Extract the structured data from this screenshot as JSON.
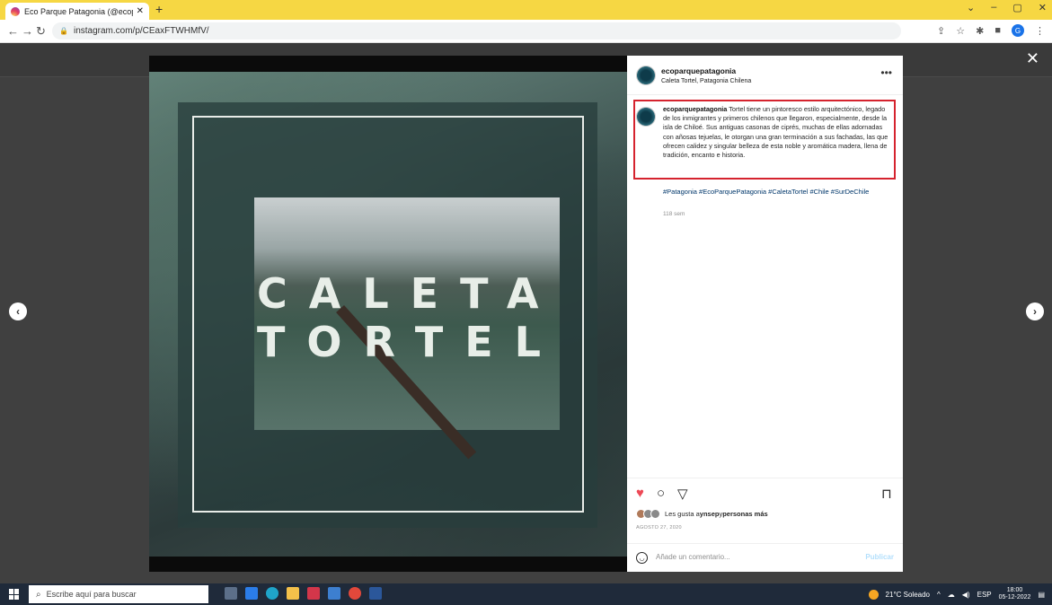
{
  "browser": {
    "tab_title": "Eco Parque Patagonia (@ecoparc",
    "tab_close": "✕",
    "new_tab": "+",
    "url": "instagram.com/p/CEaxFTWHMfV/",
    "controls": [
      "⌄",
      "–",
      "▢",
      "✕"
    ]
  },
  "post": {
    "image_title_line1": "CALETA",
    "image_title_line2": "TORTEL"
  },
  "panel": {
    "username": "ecoparquepatagonia",
    "location": "Caleta Tortel, Patagonia Chilena",
    "more": "•••",
    "caption_username": "ecoparquepatagonia",
    "caption": "Tortel tiene un pintoresco estilo arquitectónico, legado de los inmigrantes y primeros chilenos que llegaron, especialmente, desde la isla de Chiloé. Sus antiguas casonas de ciprés, muchas de ellas adornadas con añosas tejuelas, le otorgan una gran terminación a sus fachadas, las que ofrecen calidez y singular belleza de esta noble y aromática madera, llena de tradición, encanto e historia.",
    "hashtags": "#Patagonia #EcoParquePatagonia #CaletaTortel #Chile #SurDeChile",
    "time_ago": "118 sem",
    "likes_prefix": "Les gusta a ",
    "likes_user": "ynsep",
    "likes_mid": " y ",
    "likes_others": "personas más",
    "date": "AGOSTO 27, 2020",
    "comment_placeholder": "Añade un comentario...",
    "publish": "Publicar"
  },
  "taskbar": {
    "search_placeholder": "Escribe aquí para buscar",
    "weather": "21°C Soleado",
    "lang": "ESP",
    "time": "18:00",
    "date": "05-12-2022"
  },
  "colors": {
    "like_red": "#ed4956",
    "caption_highlight": "#d5232e",
    "tab_bar": "#f6d743"
  }
}
